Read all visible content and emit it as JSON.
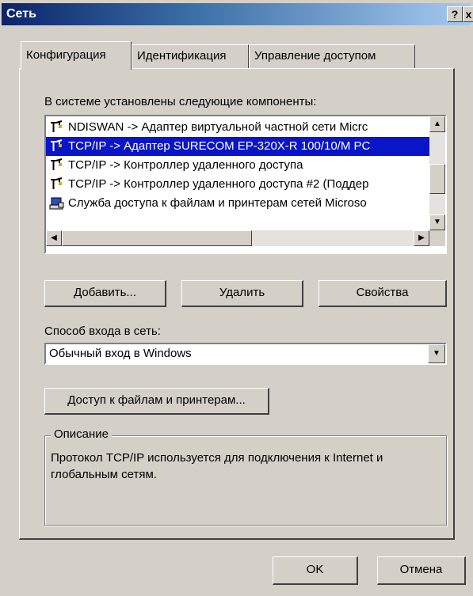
{
  "window": {
    "title": "Сеть",
    "help_label": "?",
    "close_label": "x"
  },
  "tabs": [
    {
      "label": "Конфигурация",
      "active": true
    },
    {
      "label": "Идентификация",
      "active": false
    },
    {
      "label": "Управление доступом",
      "active": false
    }
  ],
  "components": {
    "label": "В системе установлены следующие компоненты:",
    "items": [
      {
        "label": "NDISWAN -> Адаптер виртуальной частной сети Micrс",
        "icon": "network-protocol-icon",
        "selected": false
      },
      {
        "label": "TCP/IP -> Адаптер SURECOM EP-320X-R 100/10/M PC",
        "icon": "network-protocol-icon",
        "selected": true
      },
      {
        "label": "TCP/IP -> Контроллер удаленного доступа",
        "icon": "network-protocol-icon",
        "selected": false
      },
      {
        "label": "TCP/IP -> Контроллер удаленного доступа #2 (Поддер",
        "icon": "network-protocol-icon",
        "selected": false
      },
      {
        "label": "Служба доступа к файлам и принтерам сетей Microso",
        "icon": "network-service-icon",
        "selected": false
      }
    ]
  },
  "buttons": {
    "add": "Добавить...",
    "remove": "Удалить",
    "properties": "Свойства",
    "file_print": "Доступ к файлам и принтерам...",
    "ok": "OK",
    "cancel": "Отмена"
  },
  "logon": {
    "label": "Способ входа в сеть:",
    "value": "Обычный вход в Windows"
  },
  "description": {
    "title": "Описание",
    "text": "Протокол TCP/IP используется для подключения к Internet и глобальным сетям."
  },
  "colors": {
    "selection": "#0a14c8",
    "face": "#d4d0c8"
  }
}
